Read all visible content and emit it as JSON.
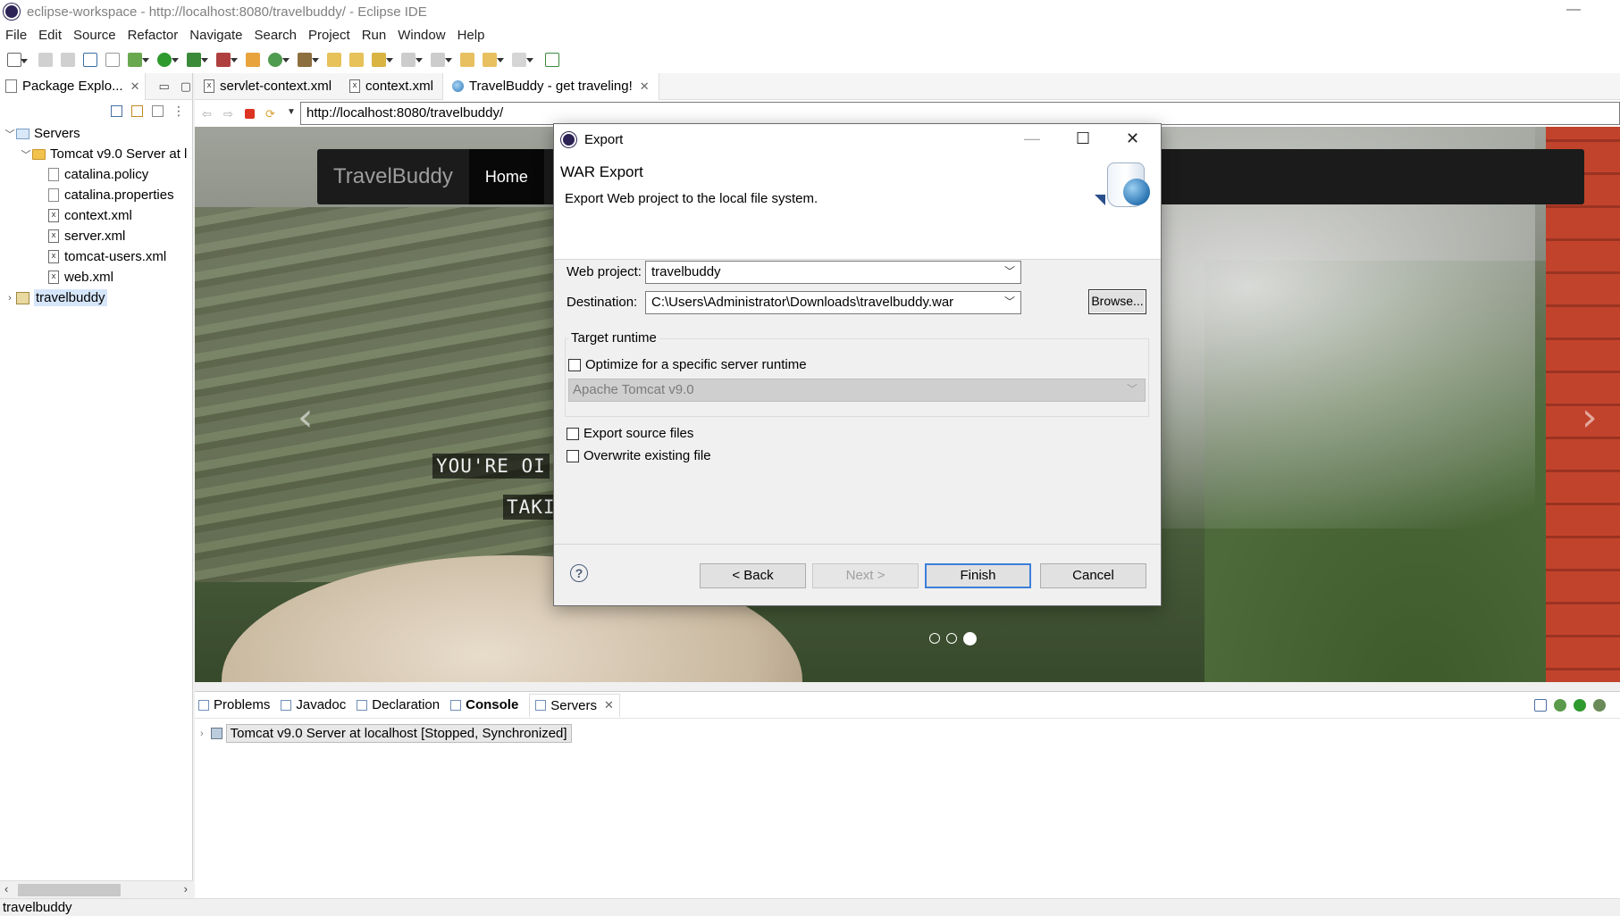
{
  "window": {
    "title": "eclipse-workspace - http://localhost:8080/travelbuddy/ - Eclipse IDE",
    "minimize_glyph": "—"
  },
  "menu": [
    "File",
    "Edit",
    "Source",
    "Refactor",
    "Navigate",
    "Search",
    "Project",
    "Run",
    "Window",
    "Help"
  ],
  "package_explorer": {
    "tab_label": "Package Explo...",
    "tree": [
      {
        "label": "Servers",
        "twisty": "﹀",
        "kind": "server-folder",
        "indent": 0
      },
      {
        "label": "Tomcat v9.0 Server at l",
        "twisty": "﹀",
        "kind": "folder",
        "indent": 1
      },
      {
        "label": "catalina.policy",
        "twisty": "",
        "kind": "file",
        "indent": 2
      },
      {
        "label": "catalina.properties",
        "twisty": "",
        "kind": "file",
        "indent": 2
      },
      {
        "label": "context.xml",
        "twisty": "",
        "kind": "xml",
        "indent": 2
      },
      {
        "label": "server.xml",
        "twisty": "",
        "kind": "xml",
        "indent": 2
      },
      {
        "label": "tomcat-users.xml",
        "twisty": "",
        "kind": "xml",
        "indent": 2
      },
      {
        "label": "web.xml",
        "twisty": "",
        "kind": "xml",
        "indent": 2
      },
      {
        "label": "travelbuddy",
        "twisty": "›",
        "kind": "project",
        "indent": 0
      }
    ]
  },
  "editor_tabs": [
    {
      "label": "servlet-context.xml",
      "icon": "xml"
    },
    {
      "label": "context.xml",
      "icon": "xml"
    },
    {
      "label": "TravelBuddy - get traveling!",
      "icon": "globe",
      "active": true
    }
  ],
  "browser": {
    "url": "http://localhost:8080/travelbuddy/",
    "brand": "TravelBuddy",
    "nav_home": "Home",
    "caption_line1": "YOU'RE OI",
    "caption_line2": "TAKI",
    "prev_arrow": "‹",
    "next_arrow": "›"
  },
  "bottom_view": {
    "tabs": [
      {
        "label": "Problems",
        "name": "tab-problems",
        "icon": "problems-icon"
      },
      {
        "label": "Javadoc",
        "name": "tab-javadoc",
        "icon": "javadoc-icon"
      },
      {
        "label": "Declaration",
        "name": "tab-declaration",
        "icon": "declaration-icon"
      },
      {
        "label": "Console",
        "name": "tab-console",
        "icon": "console-icon",
        "bold": true
      },
      {
        "label": "Servers",
        "name": "tab-servers",
        "icon": "servers-icon",
        "active": true
      }
    ],
    "server_entry": "Tomcat v9.0 Server at localhost  [Stopped, Synchronized]"
  },
  "status_bar": {
    "text": "travelbuddy"
  },
  "export_dialog": {
    "title": "Export",
    "heading": "WAR Export",
    "description": "Export Web project to the local file system.",
    "web_project_label": "Web project:",
    "web_project_value": "travelbuddy",
    "destination_label": "Destination:",
    "destination_value": "C:\\Users\\Administrator\\Downloads\\travelbuddy.war",
    "browse_label": "Browse...",
    "target_runtime_label": "Target runtime",
    "optimize_label": "Optimize for a specific server runtime",
    "runtime_value": "Apache Tomcat v9.0",
    "export_source_label": "Export source files",
    "overwrite_label": "Overwrite existing file",
    "help_glyph": "?",
    "buttons": {
      "back": "< Back",
      "next": "Next >",
      "finish": "Finish",
      "cancel": "Cancel"
    }
  }
}
